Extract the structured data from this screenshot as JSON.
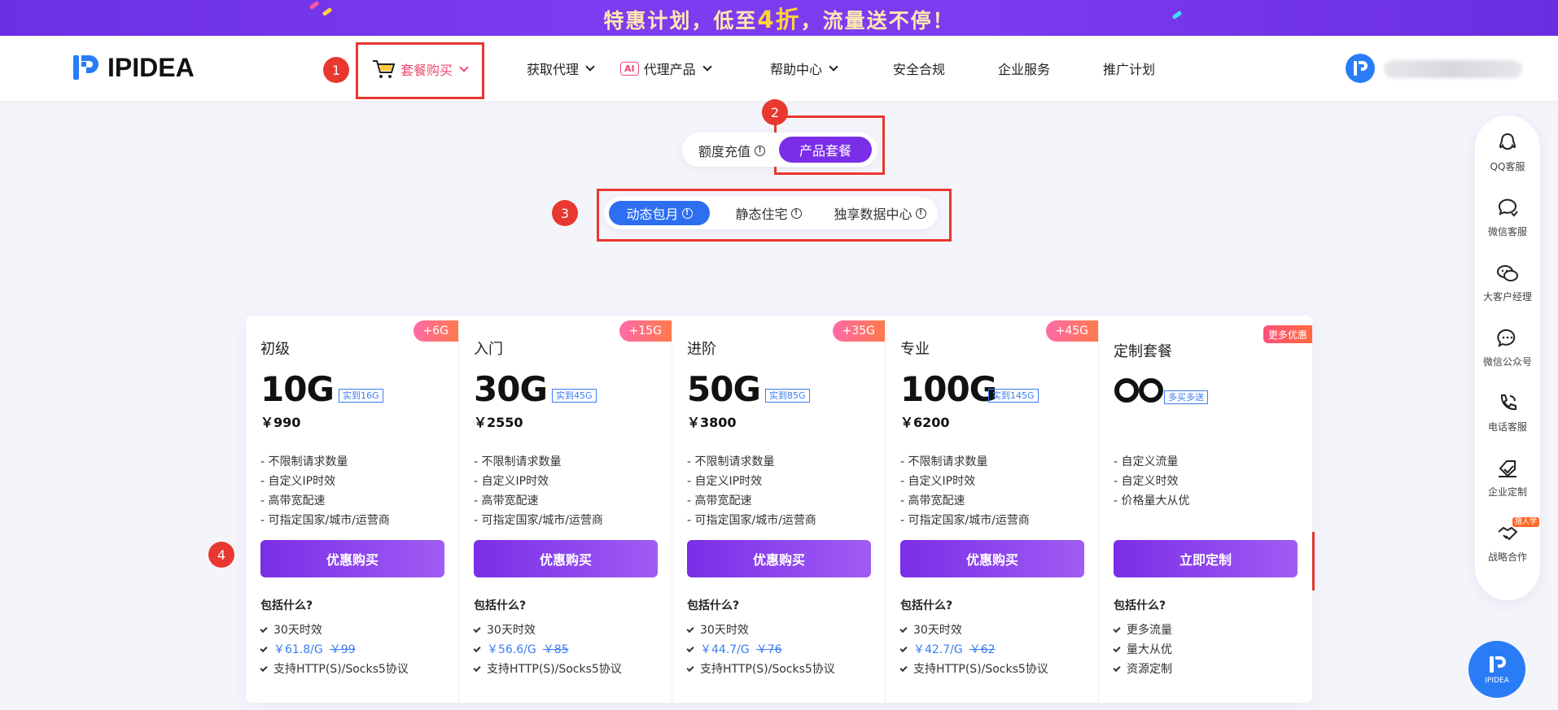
{
  "banner": {
    "text_before": "特惠计划，低至",
    "highlight": "4折",
    "text_after": "，流量送不停！"
  },
  "header": {
    "logo_text": "IPIDEA",
    "nav": [
      {
        "label": "套餐购买",
        "active": true
      },
      {
        "label": "获取代理"
      },
      {
        "label": "代理产品",
        "tag": "AI"
      },
      {
        "label": "帮助中心"
      },
      {
        "label": "安全合规"
      },
      {
        "label": "企业服务"
      },
      {
        "label": "推广计划"
      }
    ]
  },
  "annotations": [
    "1",
    "2",
    "3",
    "4"
  ],
  "mode_toggle": {
    "options": [
      "额度充值",
      "产品套餐"
    ],
    "selected": "产品套餐"
  },
  "product_tabs": {
    "tabs": [
      "动态包月",
      "静态住宅",
      "独享数据中心"
    ],
    "selected": "动态包月"
  },
  "cards": [
    {
      "name": "初级",
      "bonus": "+6G",
      "size": "10G",
      "actual": "实到16G",
      "price": "￥990",
      "features": [
        "- 不限制请求数量",
        "- 自定义IP时效",
        "- 高带宽配速",
        "- 可指定国家/城市/运营商"
      ],
      "cta": "优惠购买",
      "includes_title": "包括什么?",
      "includes": {
        "validity": "30天时效",
        "unit_price": "￥61.8/G",
        "orig_price": "￥99",
        "protocol": "支持HTTP(S)/Socks5协议"
      }
    },
    {
      "name": "入门",
      "bonus": "+15G",
      "size": "30G",
      "actual": "实到45G",
      "price": "￥2550",
      "features": [
        "- 不限制请求数量",
        "- 自定义IP时效",
        "- 高带宽配速",
        "- 可指定国家/城市/运营商"
      ],
      "cta": "优惠购买",
      "includes_title": "包括什么?",
      "includes": {
        "validity": "30天时效",
        "unit_price": "￥56.6/G",
        "orig_price": "￥85",
        "protocol": "支持HTTP(S)/Socks5协议"
      }
    },
    {
      "name": "进阶",
      "bonus": "+35G",
      "size": "50G",
      "actual": "实到85G",
      "price": "￥3800",
      "features": [
        "- 不限制请求数量",
        "- 自定义IP时效",
        "- 高带宽配速",
        "- 可指定国家/城市/运营商"
      ],
      "cta": "优惠购买",
      "includes_title": "包括什么?",
      "includes": {
        "validity": "30天时效",
        "unit_price": "￥44.7/G",
        "orig_price": "￥76",
        "protocol": "支持HTTP(S)/Socks5协议"
      }
    },
    {
      "name": "专业",
      "bonus": "+45G",
      "size": "100G",
      "actual": "实到145G",
      "price": "￥6200",
      "features": [
        "- 不限制请求数量",
        "- 自定义IP时效",
        "- 高带宽配速",
        "- 可指定国家/城市/运营商"
      ],
      "cta": "优惠购买",
      "includes_title": "包括什么?",
      "includes": {
        "validity": "30天时效",
        "unit_price": "￥42.7/G",
        "orig_price": "￥62",
        "protocol": "支持HTTP(S)/Socks5协议"
      }
    },
    {
      "name": "定制套餐",
      "bonus": "更多优惠",
      "actual": "多买多送",
      "features": [
        "- 自定义流量",
        "- 自定义时效",
        "- 价格量大从优"
      ],
      "cta": "立即定制",
      "includes_title": "包括什么?",
      "includes_list": [
        "更多流量",
        "量大从优",
        "资源定制"
      ]
    }
  ],
  "sidebar": {
    "items": [
      {
        "label": "QQ客服",
        "icon": "qq-icon"
      },
      {
        "label": "微信客服",
        "icon": "wechat-chat-icon"
      },
      {
        "label": "大客户经理",
        "icon": "manager-icon"
      },
      {
        "label": "微信公众号",
        "icon": "official-account-icon"
      },
      {
        "label": "电话客服",
        "icon": "phone-icon"
      },
      {
        "label": "企业定制",
        "icon": "enterprise-icon"
      },
      {
        "label": "战略合作",
        "icon": "handshake-icon",
        "badge": "猎人学"
      }
    ]
  },
  "float_logo_text": "IPIDEA",
  "colors": {
    "brand_purple": "#7b2ee8",
    "tab_blue": "#2d6ff0",
    "accent_pink": "#f04a6e",
    "annotation_red": "#e8382f"
  }
}
